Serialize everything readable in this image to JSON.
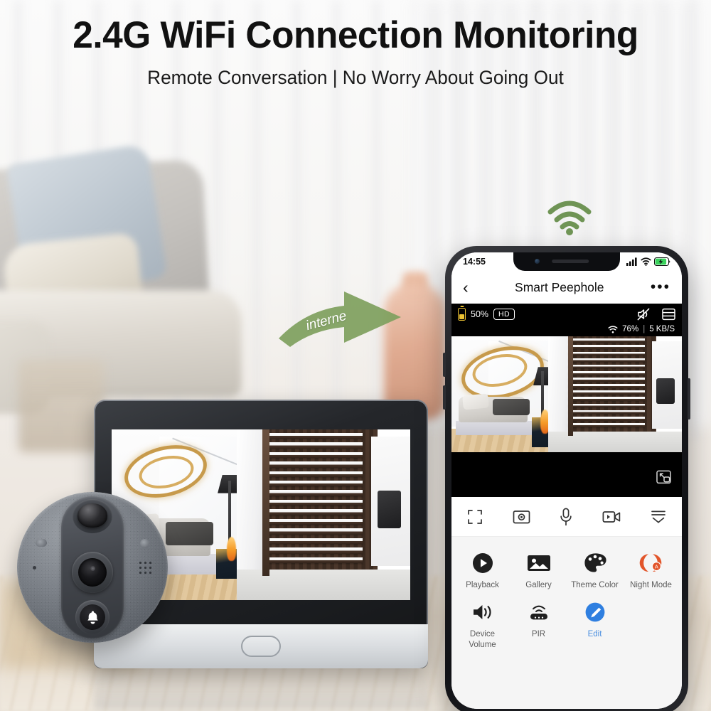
{
  "header": {
    "title": "2.4G WiFi Connection Monitoring",
    "subtitle": "Remote Conversation | No Worry About Going Out"
  },
  "annotations": {
    "arrow_label": "interne",
    "arrow_color": "#7fa05f",
    "wifi_icon_color": "#6f9455",
    "wifi_icon_name": "wifi-signal-icon"
  },
  "devices": {
    "peephole": {
      "name": "smart-peephole-camera",
      "body_color": "#7e838a",
      "parts": [
        "pir-dome-sensor",
        "light-sensor",
        "camera-lens",
        "doorbell-button",
        "speaker-grille",
        "microphone"
      ]
    },
    "monitor": {
      "name": "indoor-monitor-screen",
      "frame_color": "#24262a",
      "base_color": "#dcdfe2",
      "home_button": "home-button"
    }
  },
  "phone": {
    "status_bar": {
      "time": "14:55",
      "signal_icon": "cellular-signal-icon",
      "wifi_icon": "wifi-icon",
      "battery_icon": "battery-charging-icon",
      "battery_color": "#3ad35c"
    },
    "app_bar": {
      "back_icon": "back-chevron-icon",
      "title": "Smart Peephole",
      "menu_icon": "more-options-icon"
    },
    "video_overlay": {
      "battery_percent": "50%",
      "battery_color": "#ecc233",
      "quality_badge": "HD",
      "mute_icon": "speaker-muted-icon",
      "layout_icon": "split-layout-icon",
      "wifi_icon": "wifi-strength-icon",
      "wifi_percent": "76%",
      "divider": "|",
      "bitrate": "5 KB/S",
      "pip_icon": "picture-in-picture-icon"
    },
    "toolbar": [
      {
        "name": "fullscreen-button",
        "icon": "fullscreen-brackets-icon"
      },
      {
        "name": "snapshot-button",
        "icon": "camera-snapshot-icon"
      },
      {
        "name": "talk-button",
        "icon": "microphone-icon"
      },
      {
        "name": "record-button",
        "icon": "video-record-icon"
      },
      {
        "name": "more-button",
        "icon": "collapse-chevron-icon"
      }
    ],
    "grid_items": [
      {
        "label": "Playback",
        "icon": "playback-play-icon",
        "name": "playback-button",
        "accent": false
      },
      {
        "label": "Gallery",
        "icon": "gallery-image-icon",
        "name": "gallery-button",
        "accent": false
      },
      {
        "label": "Theme\nColor",
        "icon": "theme-palette-icon",
        "name": "theme-color-button",
        "accent": false
      },
      {
        "label": "Night\nMode",
        "icon": "night-mode-icon",
        "name": "night-mode-button",
        "accent": false,
        "badge_color": "#e2552a"
      },
      {
        "label": "Device\nVolume",
        "icon": "speaker-volume-icon",
        "name": "device-volume-button",
        "accent": false
      },
      {
        "label": "PIR",
        "icon": "pir-sensor-icon",
        "name": "pir-button",
        "accent": false
      },
      {
        "label": "Edit",
        "icon": "edit-pencil-icon",
        "name": "edit-button",
        "accent": true,
        "badge_color": "#2f7fe0"
      }
    ]
  }
}
